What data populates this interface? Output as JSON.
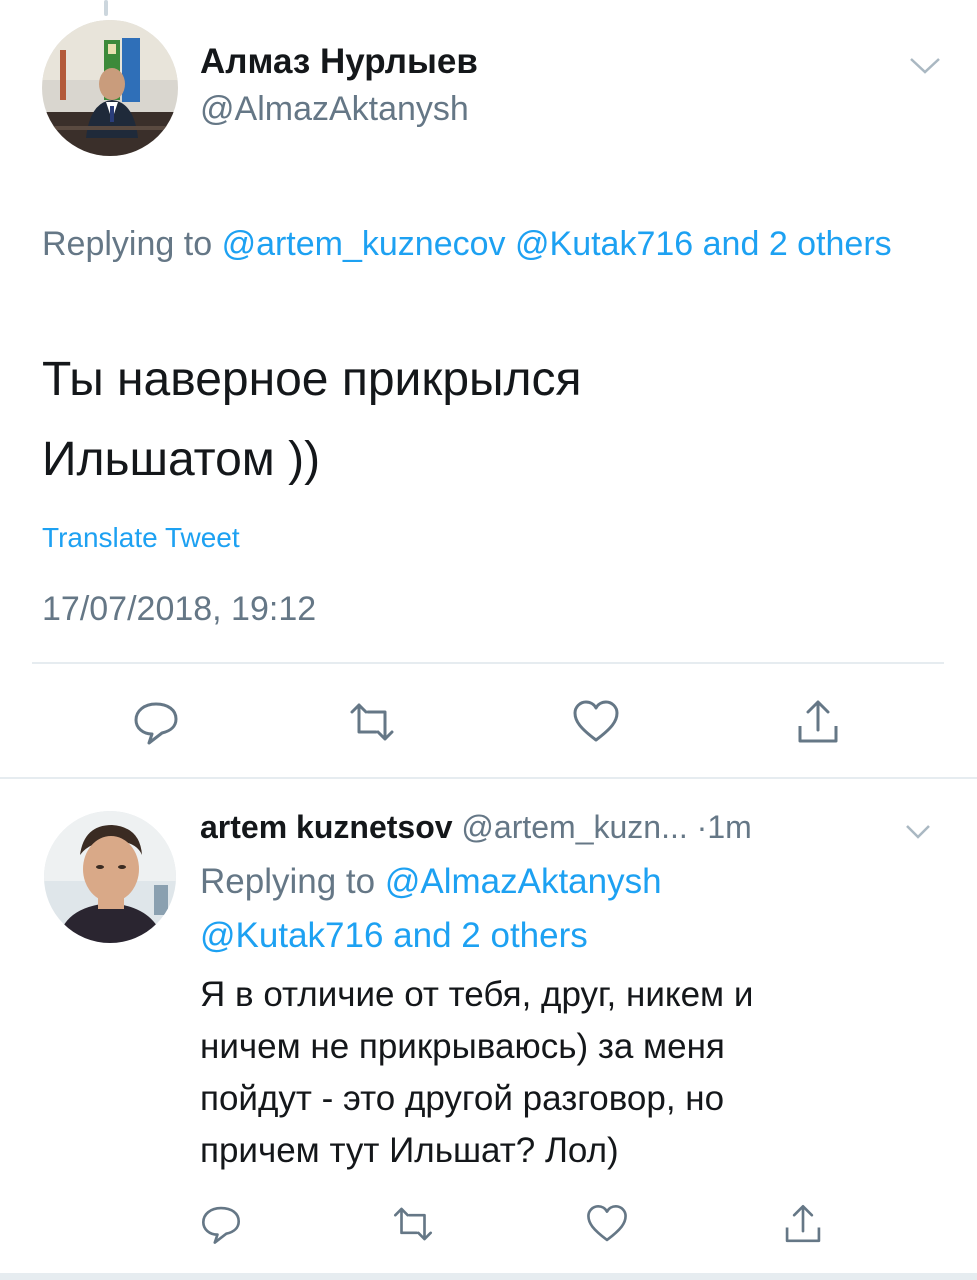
{
  "main_tweet": {
    "display_name": "Алмаз Нурлыев",
    "handle": "@AlmazAktanysh",
    "replying_prefix": "Replying to",
    "mention_1": "@artem_kuznecov",
    "mention_2": "@Kutak716",
    "and_others": "and 2 others",
    "text_line_1": "Ты наверное прикрылся",
    "text_line_2": "Ильшатом ))",
    "translate_label": "Translate Tweet",
    "timestamp": "17/07/2018, 19:12"
  },
  "reply_tweet": {
    "display_name": "artem kuznetsov",
    "handle": "@artem_kuzn...",
    "time": "·1m",
    "replying_prefix": "Replying to",
    "mention_1": "@AlmazAktanysh",
    "mention_2": "@Kutak716",
    "and_others": "and 2 others",
    "text_line_1": "Я в отличие от тебя, друг, никем и",
    "text_line_2": "ничем не прикрываюсь) за меня",
    "text_line_3": "пойдут - это другой разговор, но",
    "text_line_4": "причем тут Ильшат? Лол)"
  },
  "icons": {
    "reply": "reply-icon",
    "retweet": "retweet-icon",
    "like": "like-icon",
    "share": "share-icon",
    "chevron": "chevron-down-icon"
  },
  "colors": {
    "link": "#1da1f2",
    "secondary_text": "#657786",
    "primary_text": "#14171a",
    "divider": "#e6ecf0"
  }
}
